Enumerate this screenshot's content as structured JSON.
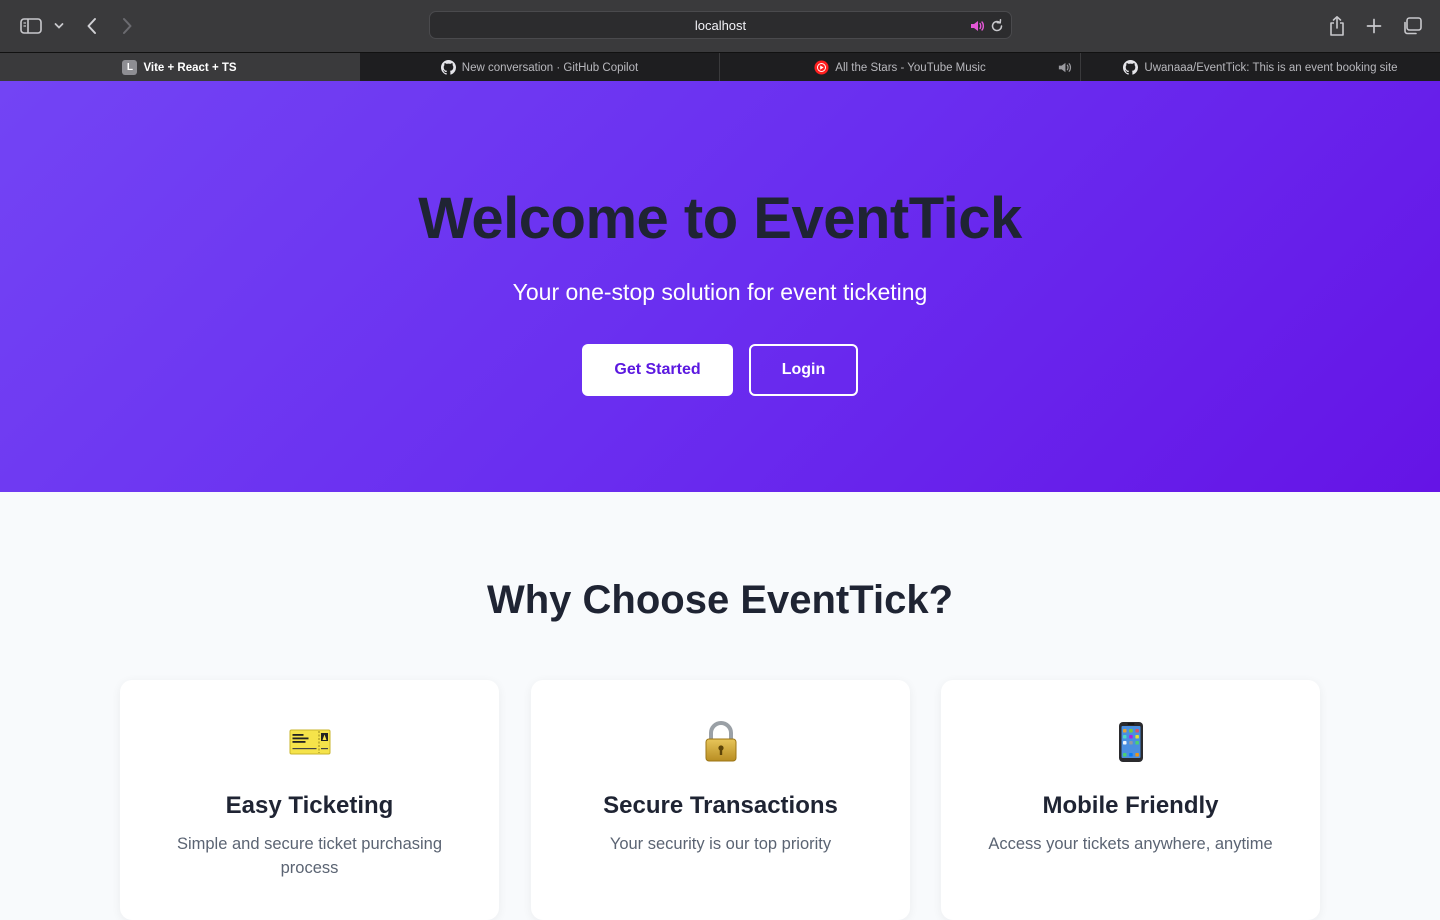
{
  "browser": {
    "url": "localhost",
    "tabs": [
      {
        "title": "Vite + React + TS",
        "favicon": "letter-l-icon",
        "favicon_letter": "L",
        "active": true
      },
      {
        "title": "New conversation · GitHub Copilot",
        "favicon": "github-icon",
        "active": false
      },
      {
        "title": "All the Stars - YouTube Music",
        "favicon": "youtube-music-icon",
        "active": false,
        "playing_audio": true
      },
      {
        "title": "Uwanaaa/EventTick: This is an event booking site",
        "favicon": "github-icon",
        "active": false
      }
    ],
    "toolbar_icons": [
      "sidebar-toggle-icon",
      "chevron-down-icon",
      "back-arrow-icon",
      "forward-arrow-icon",
      "speaker-icon",
      "reload-icon",
      "share-icon",
      "new-tab-icon",
      "tab-overview-icon"
    ]
  },
  "hero": {
    "title": "Welcome to EventTick",
    "subtitle": "Your one-stop solution for event ticketing",
    "primary_button": "Get Started",
    "secondary_button": "Login"
  },
  "features": {
    "heading": "Why Choose EventTick?",
    "cards": [
      {
        "icon": "ticket-icon",
        "title": "Easy Ticketing",
        "description": "Simple and secure ticket purchasing process"
      },
      {
        "icon": "lock-icon",
        "title": "Secure Transactions",
        "description": "Your security is our top priority"
      },
      {
        "icon": "mobile-phone-icon",
        "title": "Mobile Friendly",
        "description": "Access your tickets anywhere, anytime"
      }
    ]
  },
  "colors": {
    "hero_gradient_start": "#7344f4",
    "hero_gradient_end": "#6514e6",
    "heading_text": "#1f2433",
    "primary_button_text": "#5b18e0",
    "body_text": "#5b6473",
    "page_background": "#f8fafc"
  }
}
